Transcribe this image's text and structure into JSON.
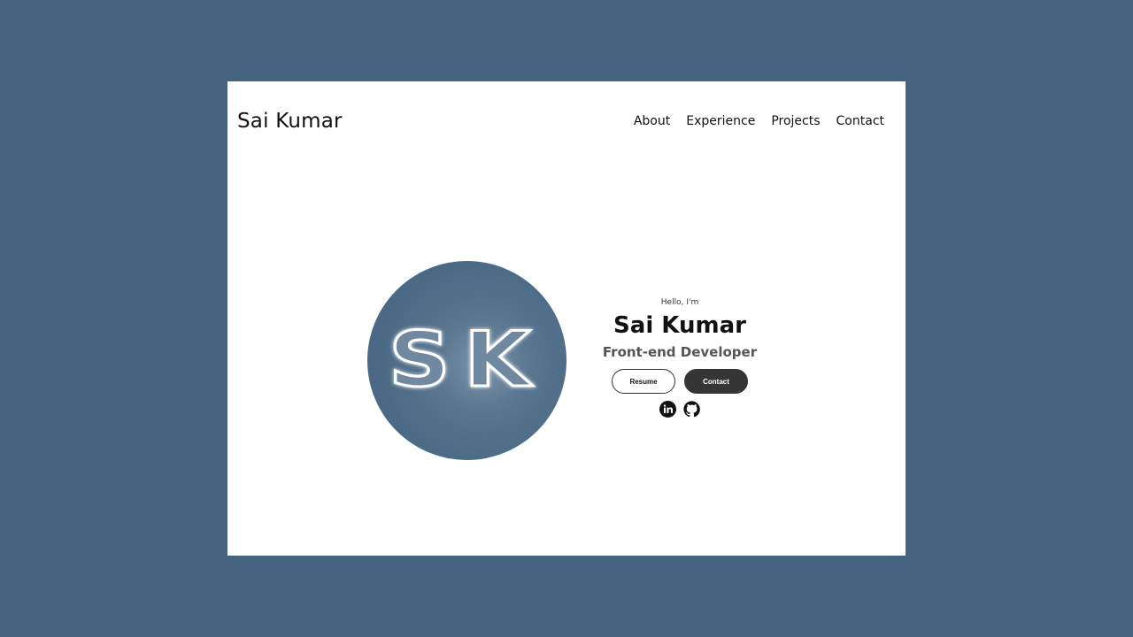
{
  "header": {
    "brand": "Sai Kumar",
    "nav": [
      {
        "label": "About"
      },
      {
        "label": "Experience"
      },
      {
        "label": "Projects"
      },
      {
        "label": "Contact"
      }
    ]
  },
  "hero": {
    "avatar_text": "SK",
    "greeting": "Hello, I'm",
    "name": "Sai Kumar",
    "role": "Front-end Developer",
    "buttons": {
      "resume": "Resume",
      "contact": "Contact"
    },
    "social": [
      {
        "icon": "linkedin-icon"
      },
      {
        "icon": "github-icon"
      }
    ]
  },
  "colors": {
    "backdrop": "#46647f",
    "surface": "#ffffff",
    "text": "#111111",
    "role_text": "#555555",
    "button_dark": "#353535"
  }
}
